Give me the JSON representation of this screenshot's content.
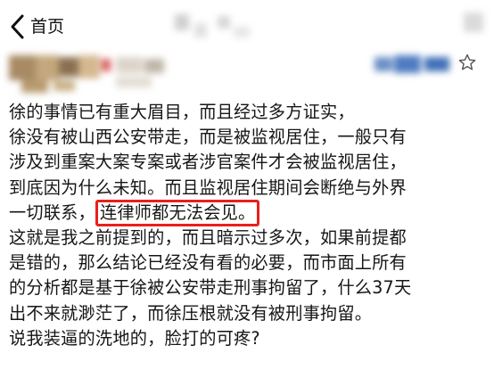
{
  "nav": {
    "back_label": "首页",
    "back_icon": "chevron-left-icon",
    "star_icon": "star-outline-icon"
  },
  "post": {
    "lines": [
      "徐的事情已有重大眉目，而且经过多方证实，",
      "徐没有被山西公安带走，而是被监视居住，一般只有",
      "涉及到重案大案专案或者涉官案件才会被监视居住，",
      "到底因为什么未知。而且监视居住期间会断绝与外界"
    ],
    "line5_prefix": "一切联系，",
    "highlighted_text": "连律师都无法会见。",
    "lines_after": [
      "这就是我之前提到的，而且暗示过多次，如果前提都",
      "是错的，那么结论已经没有看的必要，而市面上所有",
      "的分析都是基于徐被公安带走刑事拘留了，什么37天",
      "出不来就渺茫了，而徐压根就没有被刑事拘留。",
      "说我装逼的洗地的，脸打的可疼?"
    ]
  },
  "colors": {
    "highlight_border": "#e8201e",
    "text": "#161616",
    "background": "#ffffff"
  }
}
